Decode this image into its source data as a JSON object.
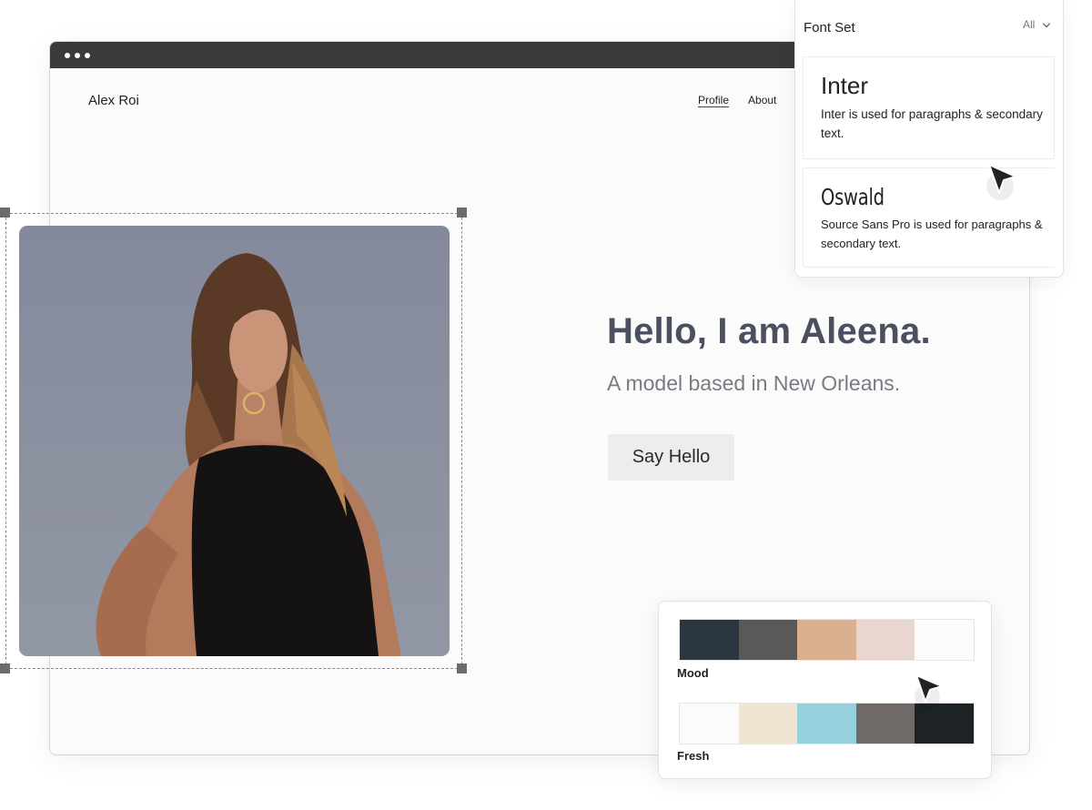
{
  "site": {
    "brand": "Alex Roi",
    "nav": [
      {
        "label": "Profile",
        "active": true
      },
      {
        "label": "About",
        "active": false
      }
    ]
  },
  "hero": {
    "title": "Hello, I am Aleena.",
    "subtitle": "A model based in New Orleans.",
    "button_label": "Say Hello"
  },
  "image": {
    "icon": "portrait-photo"
  },
  "font_panel": {
    "title": "Font Set",
    "filter_label": "All",
    "fonts": [
      {
        "name": "Inter",
        "description": "Inter is used for paragraphs & secondary text."
      },
      {
        "name": "Oswald",
        "description": "Source Sans Pro is used for paragraphs & secondary text."
      }
    ]
  },
  "palettes": [
    {
      "label": "Mood",
      "colors": [
        "#2c3542",
        "#5b5958",
        "#dbb08f",
        "#e9d6d0",
        "#fbfbfb"
      ]
    },
    {
      "label": "Fresh",
      "colors": [
        "#fbfbfb",
        "#efe5d2",
        "#94d1dc",
        "#6f6a68",
        "#1d2224"
      ]
    }
  ],
  "colors": {
    "browser_bar": "#3a3a3a",
    "hero_title": "#4a5060",
    "button_bg": "#eceeee"
  }
}
